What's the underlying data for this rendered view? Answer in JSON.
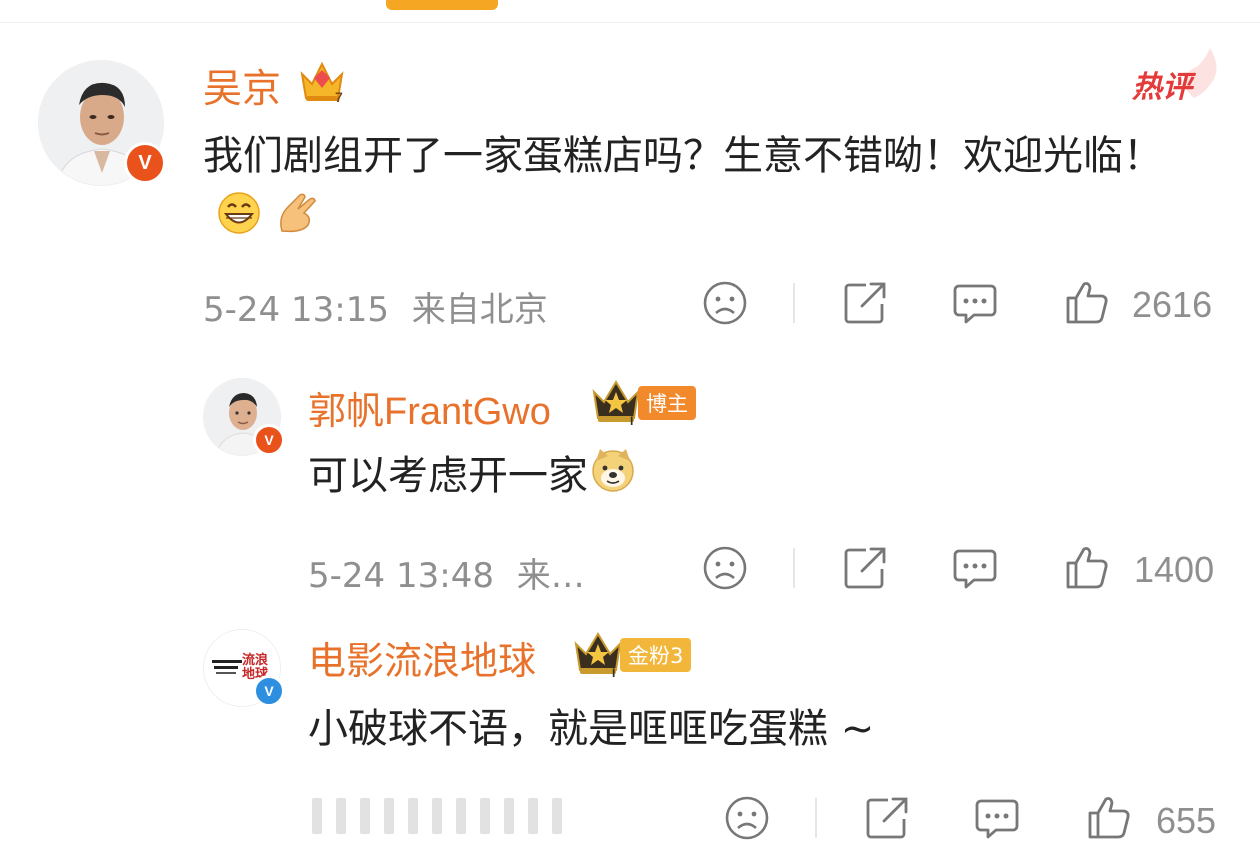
{
  "comments": [
    {
      "author": "吴京",
      "tag": "",
      "text": "我们剧组开了一家蛋糕店吗？生意不错呦！欢迎光临！",
      "emojis": [
        "grin-emoji",
        "clap-hands-emoji"
      ],
      "date": "5-24 13:15",
      "location": "来自北京",
      "likes": "2616",
      "hot_label": "热评",
      "badge_color": "#e9531b"
    },
    {
      "author": "郭帆FrantGwo",
      "tag": "博主",
      "text": "可以考虑开一家",
      "emojis": [
        "doge-emoji"
      ],
      "date": "5-24 13:48",
      "location": "来…",
      "likes": "1400",
      "badge_color": "#e9531b"
    },
    {
      "author": "电影流浪地球",
      "tag": "金粉3",
      "text": "小破球不语，就是哐哐吃蛋糕 ~",
      "emojis": [],
      "date": "",
      "location": "",
      "likes": "655",
      "badge_color": "#2e8fe0"
    }
  ],
  "colors": {
    "name": "#e8722b",
    "meta": "#8f8f8f",
    "accent": "#f5a623",
    "hot": "#e53a3a"
  },
  "avatar3_text": "流浪地球"
}
